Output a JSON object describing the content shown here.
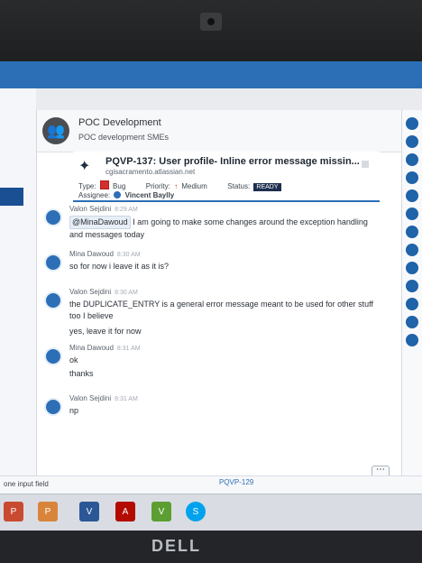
{
  "room": {
    "title": "POC Development",
    "subtitle": "POC development SMEs"
  },
  "issue": {
    "key_title": "PQVP-137: User profile- Inline error message missin...",
    "site": "cgisacramento.atlassian.net",
    "type_label": "Type:",
    "type_value": "Bug",
    "priority_label": "Priority:",
    "priority_value": "Medium",
    "status_label": "Status:",
    "status_value": "READY",
    "assignee_label": "Assignee:",
    "assignee_value": "Vincent Baylly"
  },
  "messages": [
    {
      "name": "Valon Sejdini",
      "time": "8:29 AM",
      "mention": "@MinaDawoud",
      "text": "I am going to make some changes around the exception handling and messages today"
    },
    {
      "name": "Mina Dawoud",
      "time": "8:30 AM",
      "text": "so for now i leave it as it is?"
    },
    {
      "name": "Valon Sejdini",
      "time": "8:30 AM",
      "text": "the DUPLICATE_ENTRY is a general error message meant to be used for other stuff too I believe",
      "text2": "yes, leave it for now"
    },
    {
      "name": "Mina Dawoud",
      "time": "8:31 AM",
      "text": "ok",
      "text2": "thanks"
    },
    {
      "name": "Valon Sejdini",
      "time": "8:31 AM",
      "text": "np"
    }
  ],
  "composer": {
    "placeholder": ""
  },
  "bottom": {
    "left_hint": "one input field",
    "pqvp_pill": "PQVP-129"
  },
  "taskbar": [
    {
      "label": "P",
      "color": "#c84b31"
    },
    {
      "label": "P",
      "color": "#d9843b"
    },
    {
      "label": "V",
      "color": "#2b5797"
    },
    {
      "label": "A",
      "color": "#b30b00"
    },
    {
      "label": "V",
      "color": "#5c9e31"
    },
    {
      "label": "S",
      "color": "#00a2ed"
    }
  ],
  "brand": "DELL"
}
